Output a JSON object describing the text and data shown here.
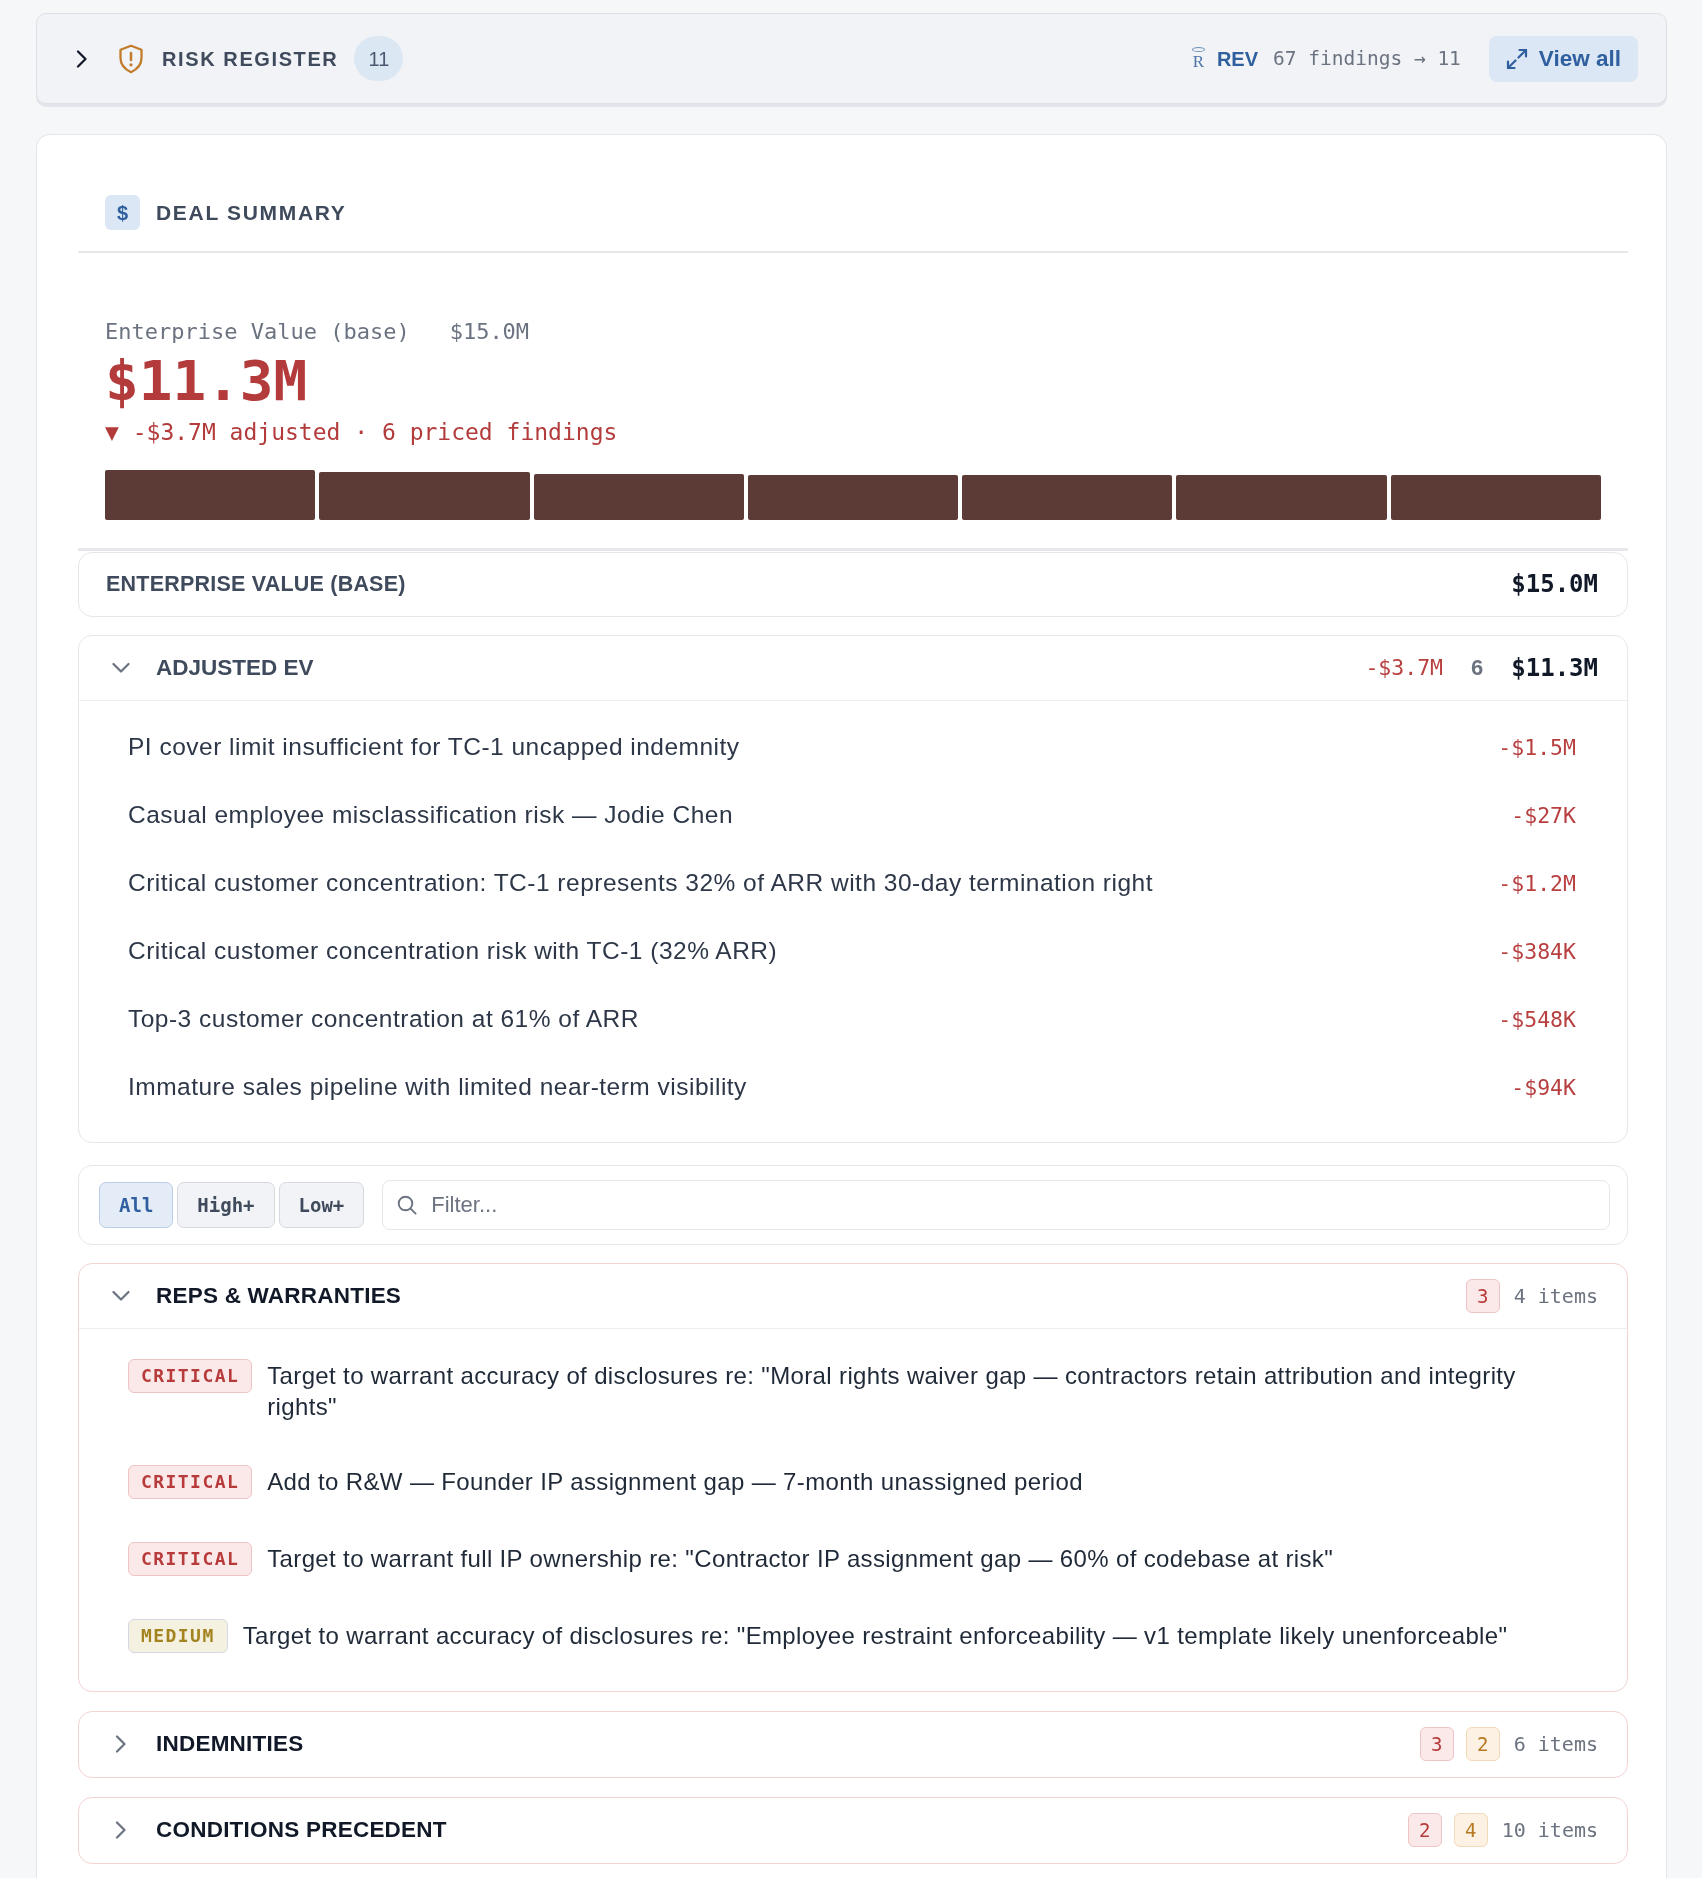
{
  "risk_register": {
    "expanded": false,
    "title": "RISK REGISTER",
    "count": "11",
    "source_icon": "R",
    "source": "REV",
    "summary": "67 findings → 11",
    "action": "View all"
  },
  "deal_summary": {
    "icon": "$",
    "title": "DEAL SUMMARY",
    "base_label": "Enterprise Value (base)",
    "base_value": "$15.0M",
    "adjusted_value": "$11.3M",
    "delta": "▼ -$3.7M adjusted · 6 priced findings",
    "ev_base": {
      "label": "ENTERPRISE VALUE (BASE)",
      "value": "$15.0M"
    },
    "adjusted_ev": {
      "expanded": true,
      "label": "ADJUSTED EV",
      "delta": "-$3.7M",
      "count": "6",
      "value": "$11.3M",
      "items": [
        {
          "text": "PI cover limit insufficient for TC-1 uncapped indemnity",
          "amount": "-$1.5M"
        },
        {
          "text": "Casual employee misclassification risk — Jodie Chen",
          "amount": "-$27K"
        },
        {
          "text": "Critical customer concentration: TC-1 represents 32% of ARR with 30-day termination right",
          "amount": "-$1.2M"
        },
        {
          "text": "Critical customer concentration risk with TC-1 (32% ARR)",
          "amount": "-$384K"
        },
        {
          "text": "Top-3 customer concentration at 61% of ARR",
          "amount": "-$548K"
        },
        {
          "text": "Immature sales pipeline with limited near-term visibility",
          "amount": "-$94K"
        }
      ]
    }
  },
  "filters": {
    "options": [
      {
        "label": "All",
        "selected": true
      },
      {
        "label": "High+",
        "selected": false
      },
      {
        "label": "Low+",
        "selected": false
      }
    ],
    "search": {
      "placeholder": "Filter..."
    }
  },
  "sections": [
    {
      "title": "REPS & WARRANTIES",
      "expanded": true,
      "counts": [
        {
          "kind": "critical",
          "count": "3"
        }
      ],
      "total": "4 items",
      "items": [
        {
          "kind": "critical",
          "label": "CRITICAL",
          "text": "Target to warrant accuracy of disclosures re: \"Moral rights waiver gap — contractors retain attribution and integrity rights\""
        },
        {
          "kind": "critical",
          "label": "CRITICAL",
          "text": "Add to R&W — Founder IP assignment gap — 7-month unassigned period"
        },
        {
          "kind": "critical",
          "label": "CRITICAL",
          "text": "Target to warrant full IP ownership re: \"Contractor IP assignment gap — 60% of codebase at risk\""
        },
        {
          "kind": "medium",
          "label": "MEDIUM",
          "text": "Target to warrant accuracy of disclosures re: \"Employee restraint enforceability — v1 template likely unenforceable\""
        }
      ]
    },
    {
      "title": "INDEMNITIES",
      "expanded": false,
      "counts": [
        {
          "kind": "critical",
          "count": "3"
        },
        {
          "kind": "high",
          "count": "2"
        }
      ],
      "total": "6 items"
    },
    {
      "title": "CONDITIONS PRECEDENT",
      "expanded": false,
      "counts": [
        {
          "kind": "critical",
          "count": "2"
        },
        {
          "kind": "high",
          "count": "4"
        }
      ],
      "total": "10 items"
    }
  ]
}
